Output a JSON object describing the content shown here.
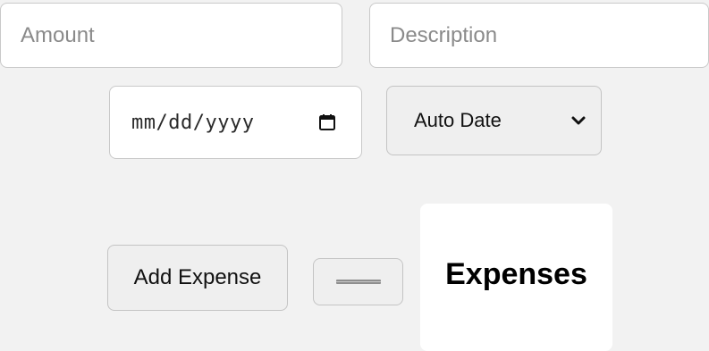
{
  "form": {
    "amount_placeholder": "Amount",
    "description_placeholder": "Description",
    "date_placeholder": "mm/dd/yyyy",
    "date_mode": {
      "selected": "Auto Date"
    },
    "add_button_label": "Add Expense"
  },
  "expenses": {
    "title": "Expenses"
  },
  "icons": {
    "date_picker": "calendar-icon",
    "select_toggle": "chevron-down-icon",
    "clear_button": "dash-icon"
  }
}
